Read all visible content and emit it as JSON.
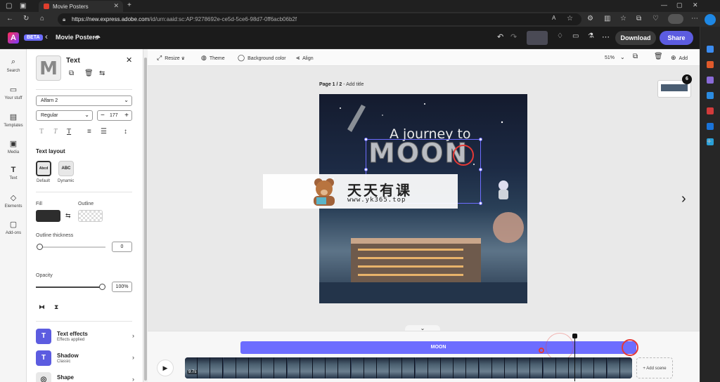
{
  "browser": {
    "tab_title": "Movie Posters",
    "url_host": "https://new.express.adobe.com",
    "url_path": "/id/urn:aaid:sc:AP:9278692e-ce5d-5ce6-98d7-0ff6acb06b2f"
  },
  "header": {
    "badge": "BETA",
    "doc_title": "Movie Posters",
    "download_label": "Download",
    "share_label": "Share"
  },
  "rail": [
    {
      "label": "Search"
    },
    {
      "label": "Your stuff"
    },
    {
      "label": "Templates"
    },
    {
      "label": "Media"
    },
    {
      "label": "Text"
    },
    {
      "label": "Elements"
    },
    {
      "label": "Add-ons"
    }
  ],
  "panel": {
    "title": "Text",
    "thumb_text": "M",
    "font_family": "Alfarn 2",
    "font_weight": "Regular",
    "font_size": "177",
    "text_layout_heading": "Text layout",
    "layout_options": [
      {
        "preview": "Abcd",
        "label": "Default"
      },
      {
        "preview": "ABC",
        "label": "Dynamic"
      }
    ],
    "fill_label": "Fill",
    "outline_label": "Outline",
    "fill_color": "#2d2d2d",
    "outline_thickness_label": "Outline thickness",
    "outline_thickness_value": "0",
    "opacity_label": "Opacity",
    "opacity_value": "100%",
    "effects": [
      {
        "title": "Text effects",
        "subtitle": "Effects applied"
      },
      {
        "title": "Shadow",
        "subtitle": "Classic"
      },
      {
        "title": "Shape",
        "subtitle": ""
      }
    ]
  },
  "toolbar": {
    "resize": "Resize",
    "theme": "Theme",
    "background_color": "Background color",
    "align": "Align",
    "zoom": "51%",
    "add": "Add"
  },
  "canvas": {
    "page_label": "Page 1 / 2",
    "add_title": " - Add title",
    "page_count": "6",
    "poster_title_top": "A journey to",
    "poster_title_main": "MOON"
  },
  "watermark": {
    "cn": "天天有课",
    "url": "www.yk365.top"
  },
  "timeline": {
    "clip_label": "MOON",
    "add_scene": "+ Add scene",
    "duration": "9.7s"
  }
}
